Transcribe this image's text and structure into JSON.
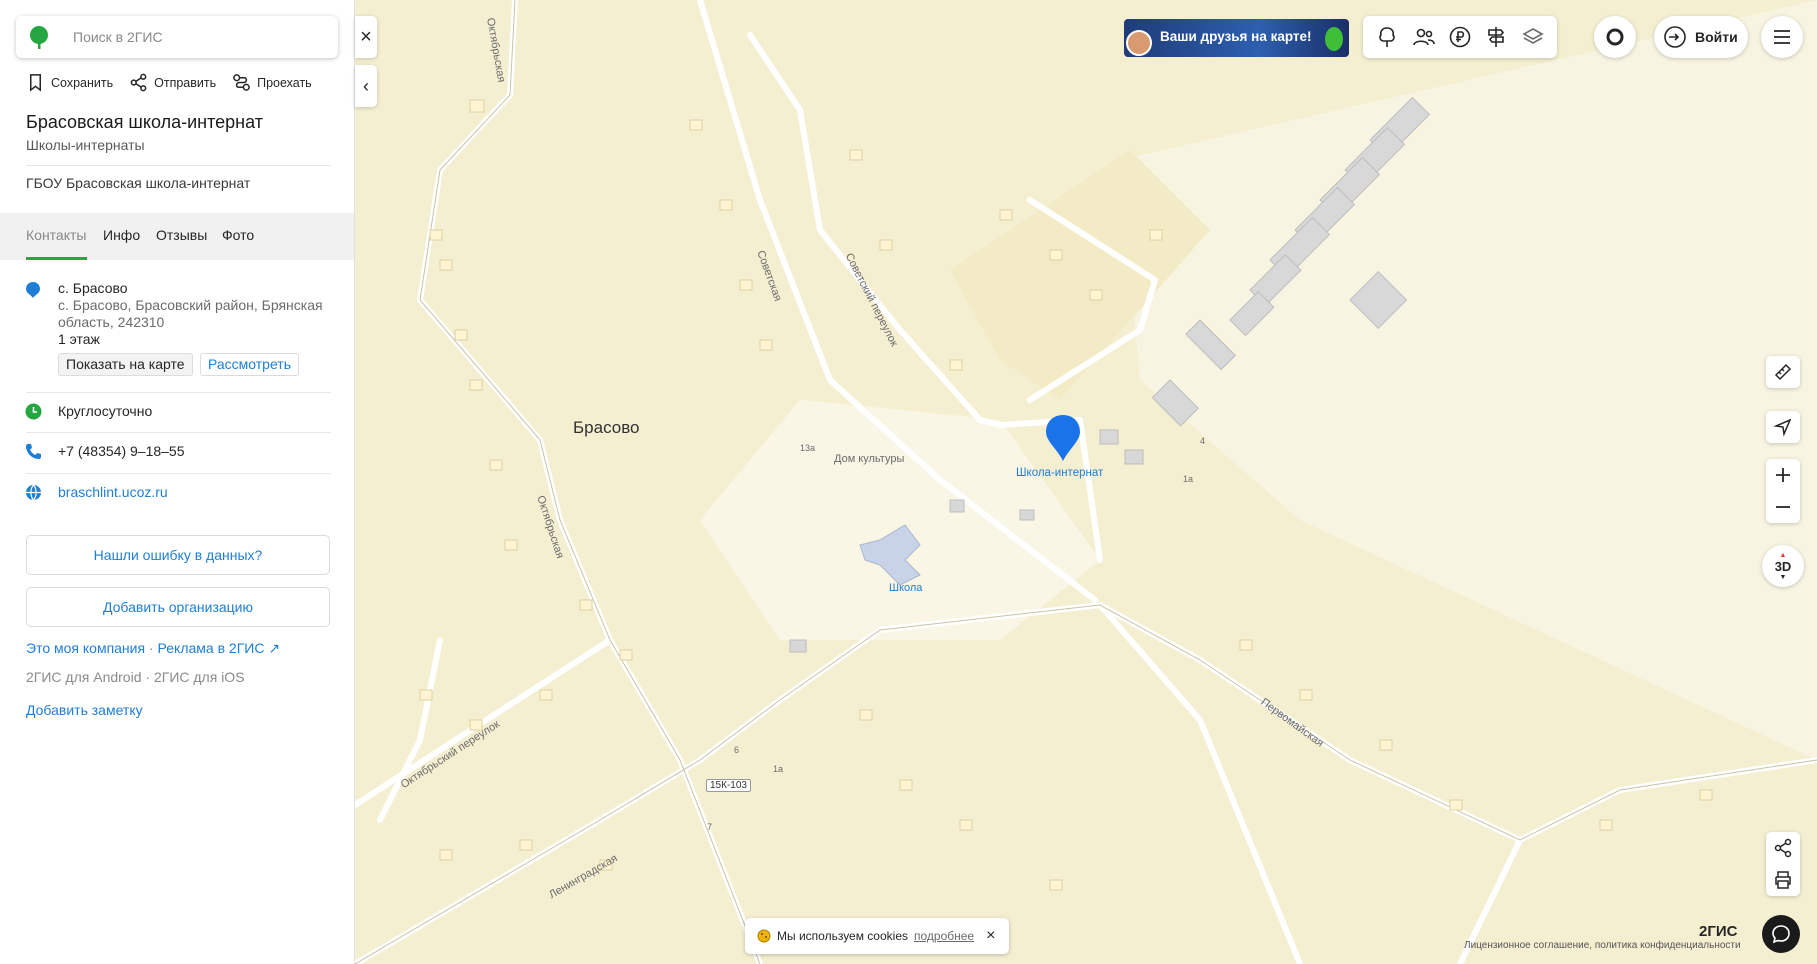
{
  "search": {
    "placeholder": "Поиск в 2ГИС"
  },
  "actions": {
    "save": "Сохранить",
    "share": "Отправить",
    "route": "Проехать"
  },
  "org": {
    "name": "Брасовская школа-интернат",
    "category": "Школы-интернаты",
    "legal_name": "ГБОУ Брасовская школа-интернат"
  },
  "tabs": [
    "Контакты",
    "Инфо",
    "Отзывы",
    "Фото"
  ],
  "contacts": {
    "address_short": "с. Брасово",
    "address_full": "с. Брасово, Брасовский район, Брянская область, 242310",
    "floor": "1 этаж",
    "show_on_map": "Показать на карте",
    "view": "Рассмотреть",
    "hours": "Круглосуточно",
    "phone": "+7 (48354) 9–18–55",
    "website": "braschlint.ucoz.ru"
  },
  "buttons": {
    "report_error": "Нашли ошибку в данных?",
    "add_org": "Добавить организацию"
  },
  "footer": {
    "my_company": "Это моя компания",
    "ads": "Реклама в 2ГИС ↗",
    "android": "2ГИС для Android",
    "ios": "2ГИС для iOS",
    "add_note": "Добавить заметку"
  },
  "topbar": {
    "promo": "Ваши друзья на карте!",
    "login": "Войти"
  },
  "map": {
    "city": "Брасово",
    "pin_label": "Школа-интернат",
    "poi_culture": "Дом культуры",
    "poi_school": "Школа",
    "road_badge": "15К-103",
    "streets": {
      "oktyabrskaya": "Октябрьская",
      "sovetskaya": "Советская",
      "sovetsky_per": "Советский переулок",
      "pervomayskaya": "Первомайская",
      "leningradskaya": "Ленинградская",
      "oktyabrsky_per": "Октябрьский переулок"
    },
    "house_numbers": [
      "13а",
      "1а",
      "4",
      "6",
      "1а",
      "7"
    ],
    "three_d": "3D"
  },
  "cookie": {
    "text": "Мы используем cookies",
    "more": "подробнее"
  },
  "brand": "2ГИС",
  "license": "Лицензионное соглашение, политика конфиденциальности",
  "colors": {
    "accent": "#26a641",
    "link": "#1e7ed6",
    "pin": "#1a73e8"
  }
}
